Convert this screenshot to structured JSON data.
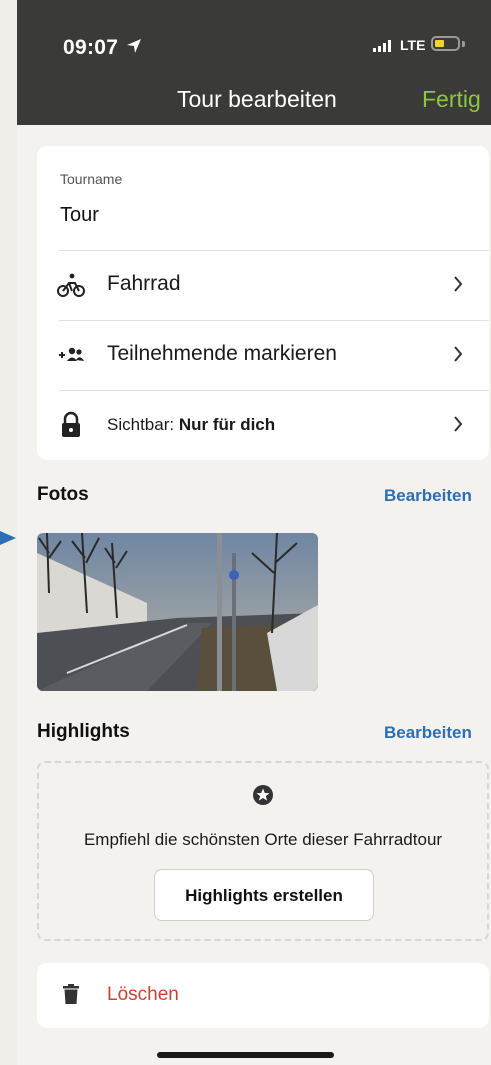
{
  "status_bar": {
    "time": "09:07",
    "network": "LTE",
    "battery_color": "#f3d12f"
  },
  "nav": {
    "title": "Tour bearbeiten",
    "done_label": "Fertig",
    "done_color": "#8cc63f"
  },
  "form": {
    "name_label": "Tourname",
    "name_value": "Tour",
    "sport_label": "Fahrrad",
    "sport_icon": "bicycle-icon",
    "participants_label": "Teilnehmende markieren",
    "participants_icon": "add-people-icon",
    "visibility_prefix": "Sichtbar: ",
    "visibility_value": "Nur für dich",
    "visibility_icon": "lock-icon"
  },
  "photos": {
    "title": "Fotos",
    "action": "Bearbeiten"
  },
  "highlights": {
    "title": "Highlights",
    "action": "Bearbeiten",
    "description": "Empfiehl die schönsten Orte dieser Fahrradtour",
    "button_label": "Highlights erstellen"
  },
  "delete": {
    "label": "Löschen",
    "color": "#c84431"
  },
  "accent_color": "#2c6fb7"
}
